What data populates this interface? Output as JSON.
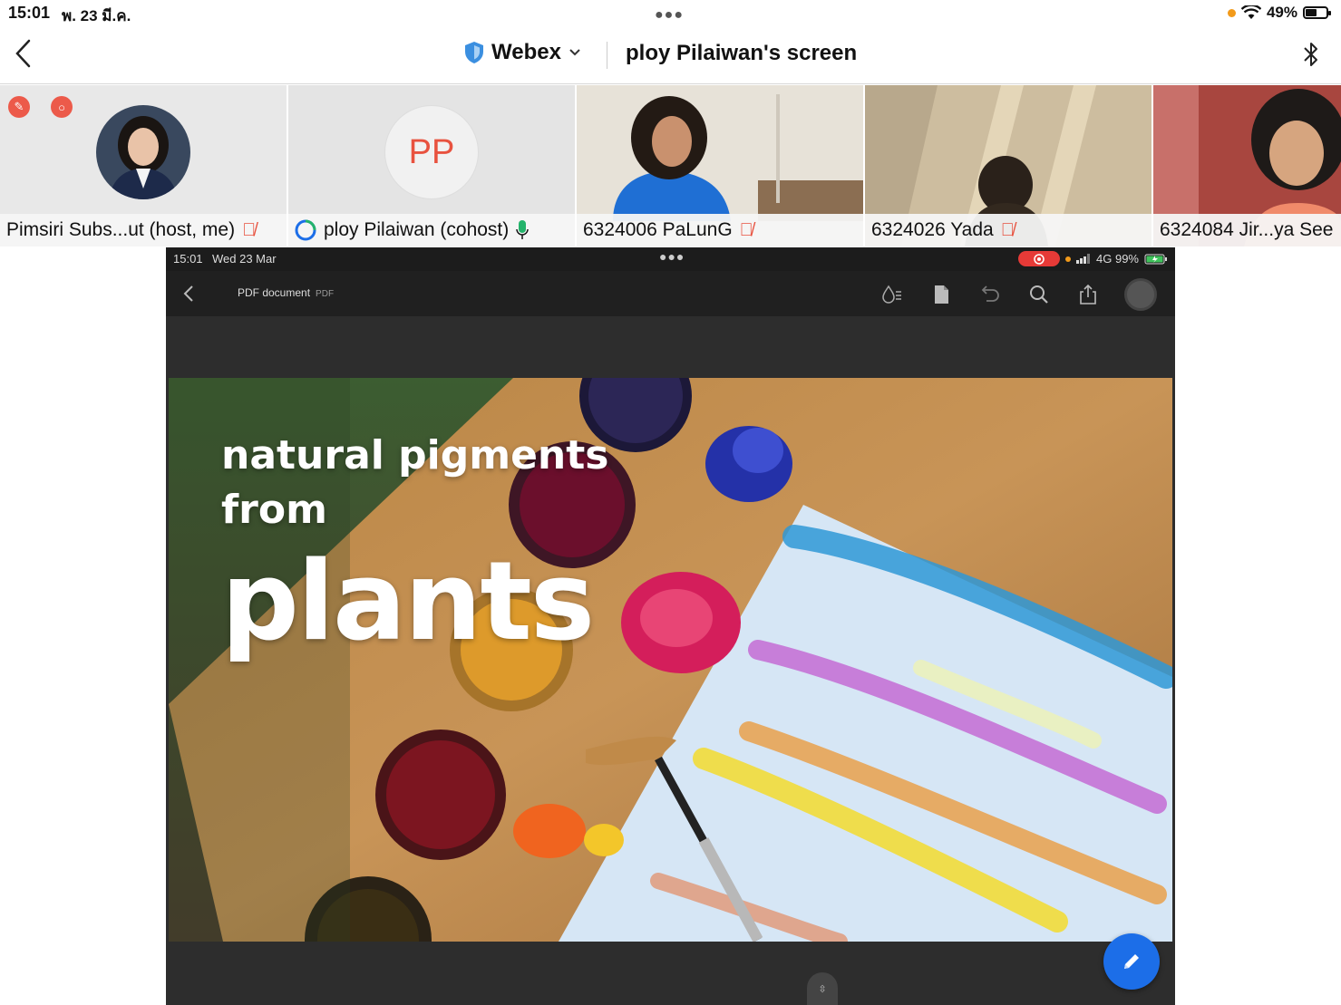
{
  "status_bar": {
    "time": "15:01",
    "date": "พ. 23 มี.ค.",
    "battery": "49%",
    "battery_level": 0.49
  },
  "nav": {
    "app_name": "Webex",
    "title": "ploy Pilaiwan's screen"
  },
  "participants": [
    {
      "label": "Pimsiri Subs...ut (host, me)",
      "muted": true
    },
    {
      "label": "ploy Pilaiwan (cohost)",
      "initials": "PP",
      "muted": false
    },
    {
      "label": "6324006 PaLunG",
      "muted": true
    },
    {
      "label": "6324026 Yada",
      "muted": true
    },
    {
      "label": "6324084 Jir...ya See"
    }
  ],
  "shared_screen": {
    "status": {
      "time": "15:01",
      "date": "Wed 23 Mar",
      "network": "4G 99%"
    },
    "toolbar": {
      "doc_name": "PDF document",
      "doc_type": "PDF"
    },
    "slide": {
      "line1": "natural pigments",
      "line2": "from",
      "line3": "plants"
    }
  },
  "colors": {
    "accent": "#1c6ee8",
    "mute": "#e8523f",
    "webex_shield": "#3b8fe0"
  }
}
